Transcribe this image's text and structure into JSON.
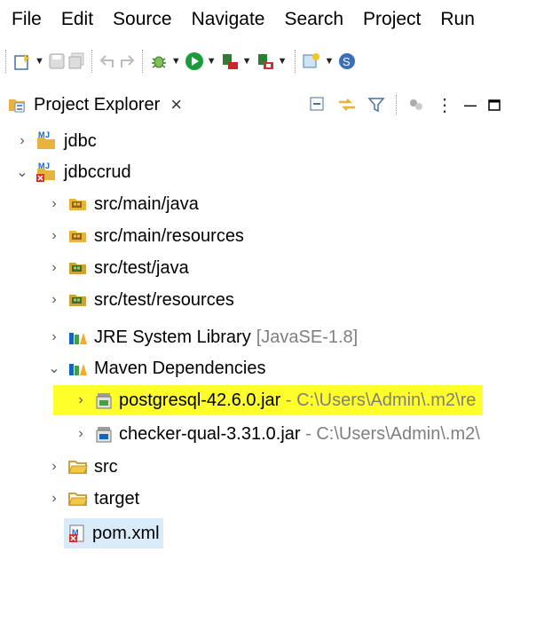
{
  "menubar": {
    "items": [
      "File",
      "Edit",
      "Source",
      "Navigate",
      "Search",
      "Project",
      "Run"
    ]
  },
  "view": {
    "tab_label": "Project Explorer",
    "close_glyph": "×",
    "menu_glyph": "⋮",
    "minimize_glyph": "—"
  },
  "tree": {
    "jdbc": "jdbc",
    "jdbccrud": "jdbccrud",
    "src_main_java": "src/main/java",
    "src_main_resources": "src/main/resources",
    "src_test_java": "src/test/java",
    "src_test_resources": "src/test/resources",
    "jre_label": "JRE System Library",
    "jre_suffix": "[JavaSE-1.8]",
    "maven_label": "Maven Dependencies",
    "postgres_label": "postgresql-42.6.0.jar",
    "postgres_suffix": " - C:\\Users\\Admin\\.m2\\re",
    "checker_label": "checker-qual-3.31.0.jar",
    "checker_suffix": " - C:\\Users\\Admin\\.m2\\",
    "src": "src",
    "target": "target",
    "pom": "pom.xml"
  },
  "colors": {
    "highlight": "#ffff2b",
    "selection": "#d9ebf9",
    "folder": "#e8b33c",
    "run": "#1a9c3a"
  }
}
